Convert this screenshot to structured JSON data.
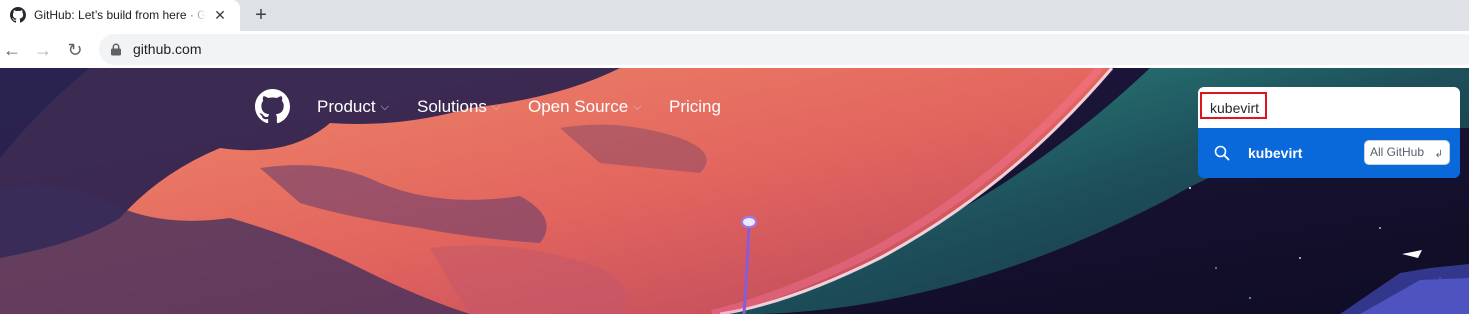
{
  "browser": {
    "tab": {
      "title": "GitHub: Let’s build from here · GitHub",
      "close_glyph": "✕",
      "favicon": "github-favicon-icon"
    },
    "new_tab_glyph": "+",
    "nav": {
      "back_glyph": "←",
      "forward_glyph": "→",
      "reload_glyph": "↻"
    },
    "omnibox": {
      "url": "github.com",
      "secure_icon": "lock-icon"
    }
  },
  "header": {
    "logo": "github-octocat-icon",
    "nav_items": [
      {
        "label": "Product",
        "has_dropdown": true
      },
      {
        "label": "Solutions",
        "has_dropdown": true
      },
      {
        "label": "Open Source",
        "has_dropdown": true
      },
      {
        "label": "Pricing",
        "has_dropdown": false
      }
    ],
    "dropdown_glyph": "⌵"
  },
  "search": {
    "value": "kubevirt",
    "suggestion": {
      "icon": "search-icon",
      "text": "kubevirt",
      "scope": "All GitHub",
      "enter_glyph": "↲"
    }
  },
  "colors": {
    "chrome_tabstrip": "#dee1e6",
    "omnibox_bg": "#f1f3f4",
    "page_sky": "#16112d",
    "suggestion_highlight": "#0a69da",
    "annotation_box": "#e0141e"
  }
}
